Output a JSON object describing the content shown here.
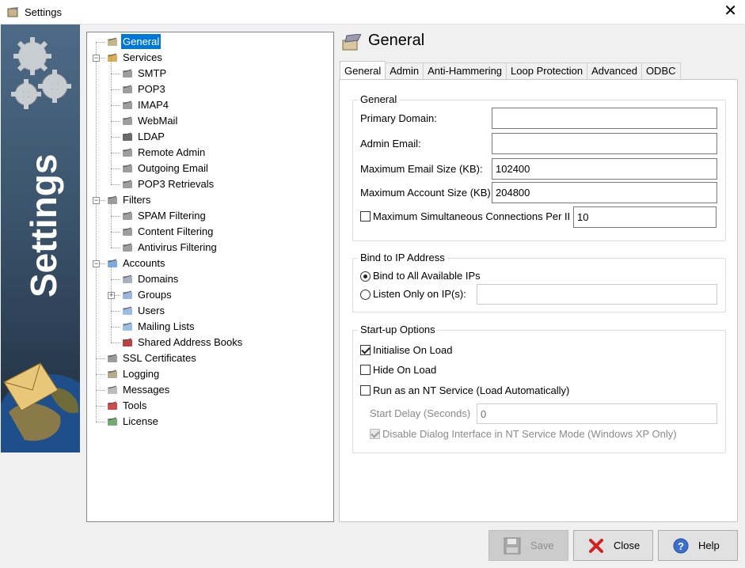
{
  "window": {
    "title": "Settings",
    "close_glyph": "✕"
  },
  "banner": {
    "text": "Settings"
  },
  "tree": {
    "items": [
      {
        "label": "General",
        "icon": "general-icon"
      },
      {
        "label": "Services",
        "icon": "services-icon"
      },
      {
        "label": "SMTP",
        "icon": "smtp-icon"
      },
      {
        "label": "POP3",
        "icon": "pop3-icon"
      },
      {
        "label": "IMAP4",
        "icon": "imap4-icon"
      },
      {
        "label": "WebMail",
        "icon": "webmail-icon"
      },
      {
        "label": "LDAP",
        "icon": "ldap-icon"
      },
      {
        "label": "Remote Admin",
        "icon": "remote-admin-icon"
      },
      {
        "label": "Outgoing Email",
        "icon": "outgoing-email-icon"
      },
      {
        "label": "POP3 Retrievals",
        "icon": "pop3-retrievals-icon"
      },
      {
        "label": "Filters",
        "icon": "filters-icon"
      },
      {
        "label": "SPAM Filtering",
        "icon": "spam-filtering-icon"
      },
      {
        "label": "Content Filtering",
        "icon": "content-filtering-icon"
      },
      {
        "label": "Antivirus Filtering",
        "icon": "antivirus-icon"
      },
      {
        "label": "Accounts",
        "icon": "folder-icon"
      },
      {
        "label": "Domains",
        "icon": "domains-icon"
      },
      {
        "label": "Groups",
        "icon": "groups-icon"
      },
      {
        "label": "Users",
        "icon": "users-icon"
      },
      {
        "label": "Mailing Lists",
        "icon": "mailing-lists-icon"
      },
      {
        "label": "Shared Address Books",
        "icon": "address-book-icon"
      },
      {
        "label": "SSL Certificates",
        "icon": "ssl-certificate-icon"
      },
      {
        "label": "Logging",
        "icon": "logging-icon"
      },
      {
        "label": "Messages",
        "icon": "messages-icon"
      },
      {
        "label": "Tools",
        "icon": "tools-icon"
      },
      {
        "label": "License",
        "icon": "license-icon"
      }
    ]
  },
  "main": {
    "title": "General",
    "tabs": [
      {
        "label": "General",
        "active": true
      },
      {
        "label": "Admin"
      },
      {
        "label": "Anti-Hammering"
      },
      {
        "label": "Loop Protection"
      },
      {
        "label": "Advanced"
      },
      {
        "label": "ODBC"
      }
    ],
    "general_group": {
      "legend": "General",
      "primary_domain_label": "Primary Domain:",
      "primary_domain_value": "",
      "admin_email_label": "Admin Email:",
      "admin_email_value": "",
      "max_email_size_label": "Maximum Email Size (KB):",
      "max_email_size_value": "102400",
      "max_account_size_label": "Maximum Account Size (KB)",
      "max_account_size_value": "204800",
      "max_connections_label": "Maximum Simultaneous Connections Per IP",
      "max_connections_value": "10"
    },
    "bind_group": {
      "legend": "Bind to IP Address",
      "bind_all_label": "Bind to All Available IPs",
      "listen_only_label": "Listen Only on IP(s):",
      "listen_only_value": ""
    },
    "startup_group": {
      "legend": "Start-up Options",
      "initialise_label": "Initialise On Load",
      "hide_label": "Hide On Load",
      "nt_service_label": "Run as an NT Service (Load Automatically)",
      "start_delay_label": "Start Delay (Seconds)",
      "start_delay_value": "0",
      "disable_dialog_label": "Disable Dialog Interface in NT Service Mode (Windows XP Only)"
    }
  },
  "buttons": {
    "save": "Save",
    "close": "Close",
    "help": "Help"
  },
  "colors": {
    "selection": "#0078d7",
    "banner": "#3d566f"
  }
}
